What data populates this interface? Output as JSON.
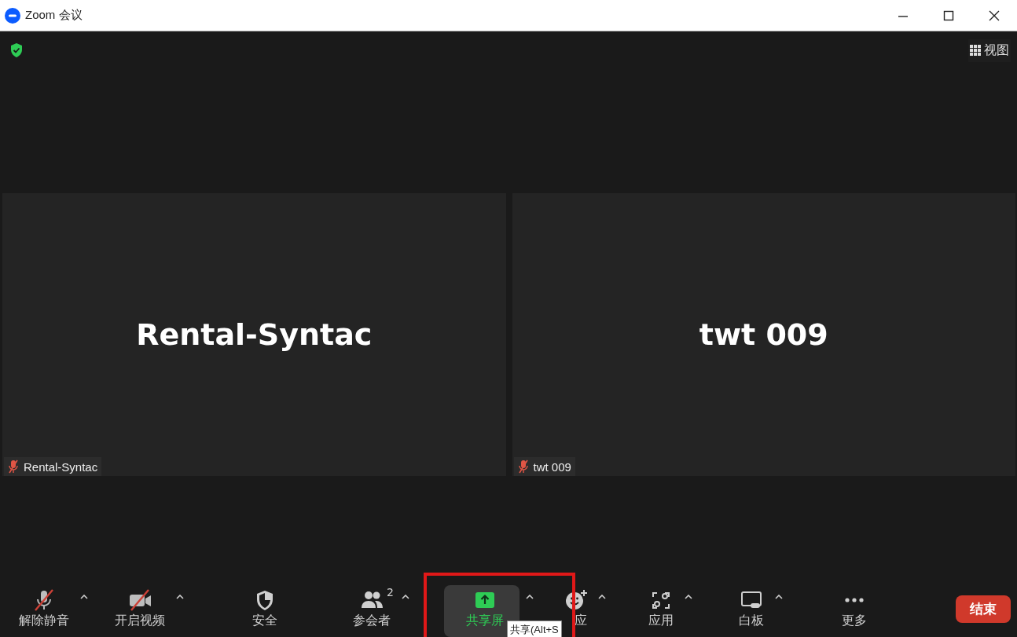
{
  "window": {
    "title": "Zoom 会议"
  },
  "top_bar": {
    "encrypted": true,
    "view_button": "视图"
  },
  "tiles": [
    {
      "name": "Rental-Syntac",
      "tag": "Rental-Syntac",
      "muted": true
    },
    {
      "name": "twt 009",
      "tag": "twt 009",
      "muted": true
    }
  ],
  "toolbar": [
    {
      "kind": "mic",
      "label": "解除静音",
      "caret": true,
      "active": false,
      "off": true
    },
    {
      "kind": "video",
      "label": "开启视频",
      "caret": true,
      "active": false,
      "off": true
    },
    {
      "kind": "security",
      "label": "安全",
      "caret": false,
      "active": false,
      "off": false
    },
    {
      "kind": "participants",
      "label": "参会者",
      "count": "2",
      "caret": true,
      "active": false,
      "off": false
    },
    {
      "kind": "share",
      "label": "共享屏",
      "caret": true,
      "active": true,
      "off": false
    },
    {
      "kind": "reactions",
      "label": "应",
      "caret": true,
      "active": false,
      "off": false
    },
    {
      "kind": "apps",
      "label": "应用",
      "caret": true,
      "active": false,
      "off": false
    },
    {
      "kind": "whiteboard",
      "label": "白板",
      "caret": true,
      "active": false,
      "off": false
    },
    {
      "kind": "more",
      "label": "更多",
      "caret": false,
      "active": false,
      "off": false
    }
  ],
  "end_button": "结束",
  "tooltip": "共享(Alt+S",
  "highlight_box": true
}
